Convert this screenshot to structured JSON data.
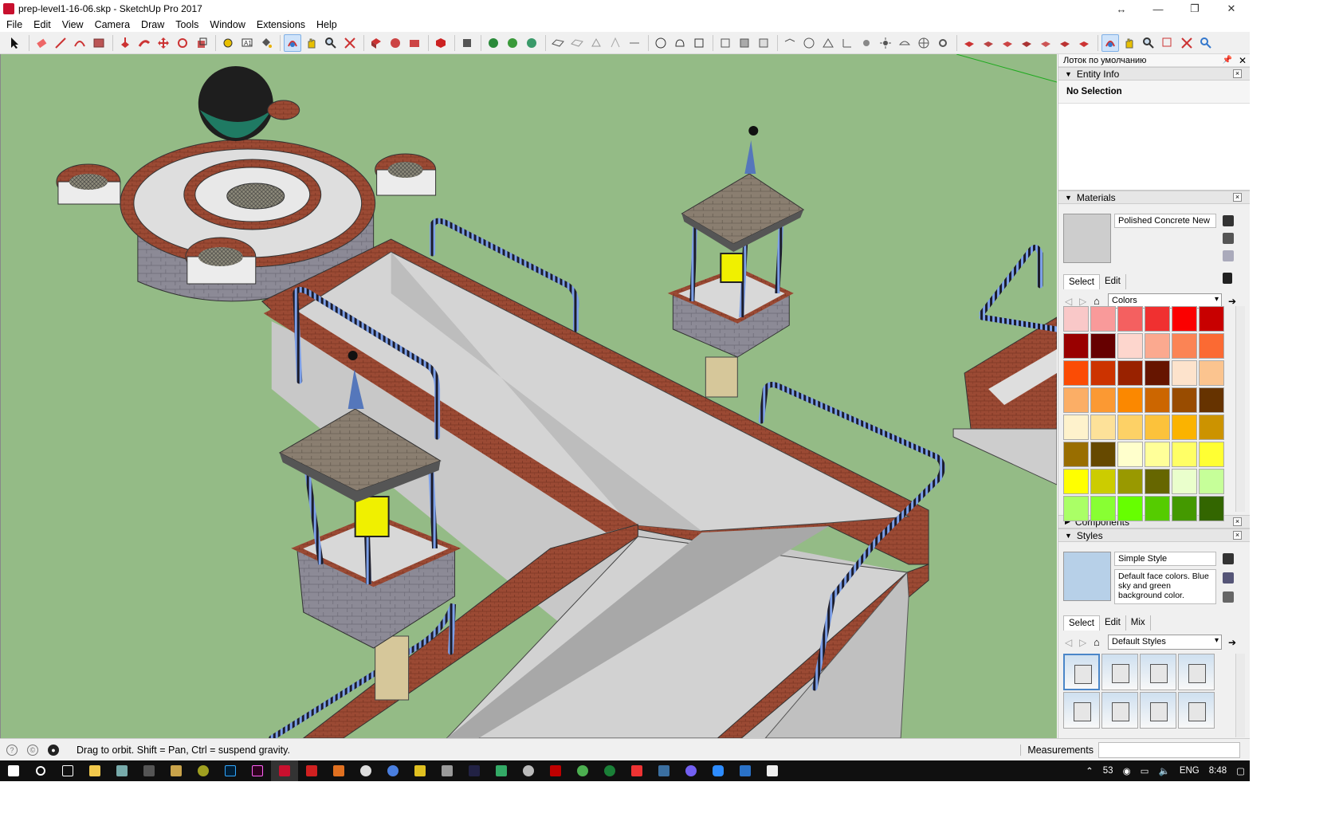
{
  "window": {
    "title": "prep-level1-16-06.skp - SketchUp Pro 2017",
    "controls": [
      "↔",
      "—",
      "❐",
      "✕"
    ]
  },
  "menu": [
    "File",
    "Edit",
    "View",
    "Camera",
    "Draw",
    "Tools",
    "Window",
    "Extensions",
    "Help"
  ],
  "tray": {
    "title": "Лоток по умолчанию",
    "entity_info": {
      "header": "Entity Info",
      "selection": "No Selection"
    },
    "materials": {
      "header": "Materials",
      "material_name": "Polished Concrete New",
      "tabs": [
        "Select",
        "Edit"
      ],
      "library": "Colors",
      "swatches": [
        "#f9c8c8",
        "#f99a9a",
        "#f46060",
        "#f03030",
        "#fb0000",
        "#c80000",
        "#990000",
        "#660000",
        "#fdd6cd",
        "#fba98f",
        "#fb8455",
        "#fb6a33",
        "#fb4c05",
        "#cc3300",
        "#992200",
        "#661500",
        "#fde3cc",
        "#fbc48f",
        "#fbae66",
        "#fb9933",
        "#fb8800",
        "#cc6600",
        "#994c00",
        "#663300",
        "#fef2cc",
        "#fde199",
        "#fdd166",
        "#fcc23b",
        "#fbb300",
        "#cc9300",
        "#996e00",
        "#664900",
        "#ffffcc",
        "#ffff99",
        "#ffff66",
        "#ffff33",
        "#ffff00",
        "#cccc00",
        "#999900",
        "#666600",
        "#eaffcc",
        "#c6ff99",
        "#aaff66",
        "#88ff33",
        "#66ff00",
        "#55cc00",
        "#449900",
        "#336600"
      ]
    },
    "components": {
      "header": "Components"
    },
    "styles": {
      "header": "Styles",
      "style_name": "Simple Style",
      "description": "Default face colors. Blue sky and green background color.",
      "tabs": [
        "Select",
        "Edit",
        "Mix"
      ],
      "library": "Default Styles"
    }
  },
  "status": {
    "message": "Drag to orbit. Shift = Pan, Ctrl = suspend gravity.",
    "measurements_label": "Measurements",
    "measurements_value": ""
  },
  "taskbar": {
    "keyboard": "ENG",
    "time": "8:48",
    "tray_number": "53"
  },
  "colors": {
    "viewport_background": "#94bb86",
    "brick": "#9b4a34",
    "concrete": "#d2d2d2",
    "stone": "#8c8a96",
    "roof": "#8a7a6a",
    "rail": "#7c9fe8",
    "lamp": "#f0f000"
  }
}
